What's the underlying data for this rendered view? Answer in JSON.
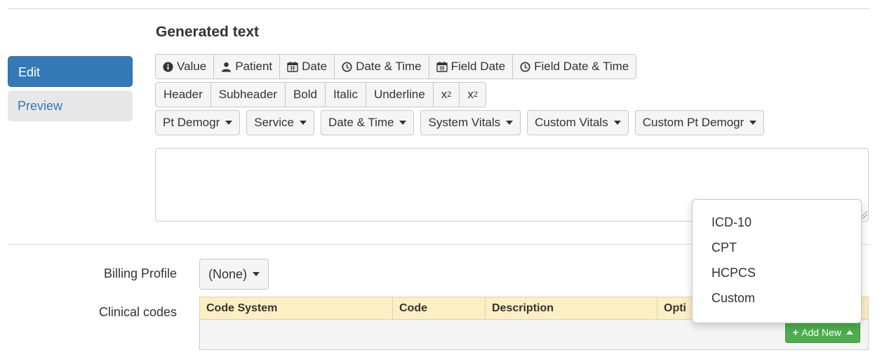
{
  "section_title": "Generated text",
  "mode_tabs": {
    "edit": "Edit",
    "preview": "Preview"
  },
  "insert_buttons": {
    "value": "Value",
    "patient": "Patient",
    "date": "Date",
    "date_time": "Date & Time",
    "field_date": "Field Date",
    "field_date_time": "Field Date & Time"
  },
  "format_buttons": {
    "header": "Header",
    "subheader": "Subheader",
    "bold": "Bold",
    "italic": "Italic",
    "underline": "Underline",
    "subscript_base": "x",
    "subscript_mark": "2",
    "superscript_base": "x",
    "superscript_mark": "2"
  },
  "dropdowns": {
    "pt_demogr": "Pt Demogr",
    "service": "Service",
    "date_time": "Date & Time",
    "system_vitals": "System Vitals",
    "custom_vitals": "Custom Vitals",
    "custom_pt_demogr": "Custom Pt Demogr"
  },
  "editor": {
    "value": ""
  },
  "billing": {
    "label": "Billing Profile",
    "selected": "(None)"
  },
  "clinical_codes": {
    "label": "Clinical codes",
    "columns": [
      "Code System",
      "Code",
      "Description",
      "Opti"
    ],
    "add_new_label": "Add New"
  },
  "add_new_menu": {
    "items": [
      "ICD-10",
      "CPT",
      "HCPCS",
      "Custom"
    ]
  },
  "colors": {
    "primary": "#337ab7",
    "success": "#4cae4c",
    "table_header": "#fcefc4"
  }
}
